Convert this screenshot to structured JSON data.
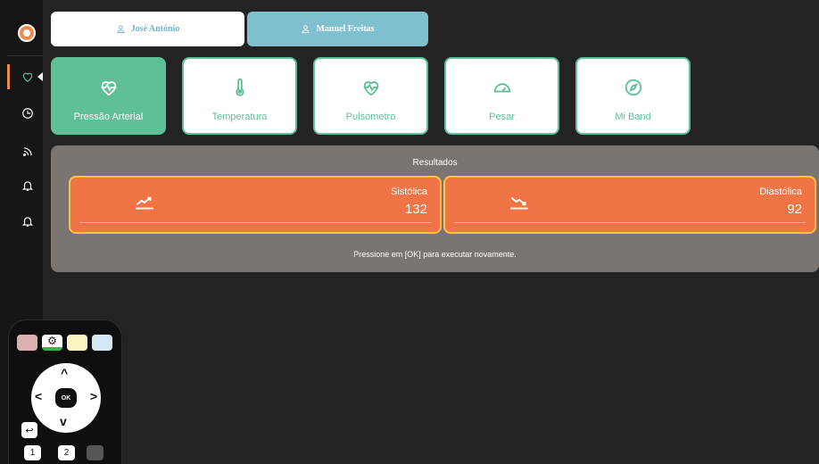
{
  "users": [
    {
      "name": "José António",
      "icon": "user-icon",
      "selected": false
    },
    {
      "name": "Manuel Freitas",
      "icon": "user-icon",
      "selected": true
    }
  ],
  "sidebar": {
    "items": [
      {
        "icon": "heart-icon",
        "active": true
      },
      {
        "icon": "clock-icon"
      },
      {
        "icon": "rss-icon"
      },
      {
        "icon": "bell-icon"
      },
      {
        "icon": "bell-icon"
      }
    ]
  },
  "measures": [
    {
      "label": "Pressão Arterial",
      "icon": "heart-pulse-icon",
      "active": true
    },
    {
      "label": "Temperatura",
      "icon": "thermometer-icon",
      "active": false
    },
    {
      "label": "Pulsometro",
      "icon": "heart-pulse-icon",
      "active": false
    },
    {
      "label": "Pesar",
      "icon": "gauge-icon",
      "active": false
    },
    {
      "label": "Mi Band",
      "icon": "compass-icon",
      "active": false
    }
  ],
  "results": {
    "title": "Resultados",
    "items": [
      {
        "name": "Sistólica",
        "value": "132",
        "icon": "trend-up-icon"
      },
      {
        "name": "Diastólica",
        "value": "92",
        "icon": "trend-down-icon"
      }
    ],
    "footer": "Pressione em [OK] para executar novamente."
  },
  "remote": {
    "ok_label": "OK",
    "numbers": [
      "1",
      "2"
    ],
    "colors": {
      "red": "#d9b2b0",
      "green": "#3bb34a",
      "yellow": "#fbf5c4",
      "blue": "#d6e6f3"
    }
  },
  "colors": {
    "accent_green": "#5fbf96",
    "accent_orange": "#f07446",
    "tab_blue": "#7fbfcf",
    "panel_gray": "#7a7571"
  }
}
